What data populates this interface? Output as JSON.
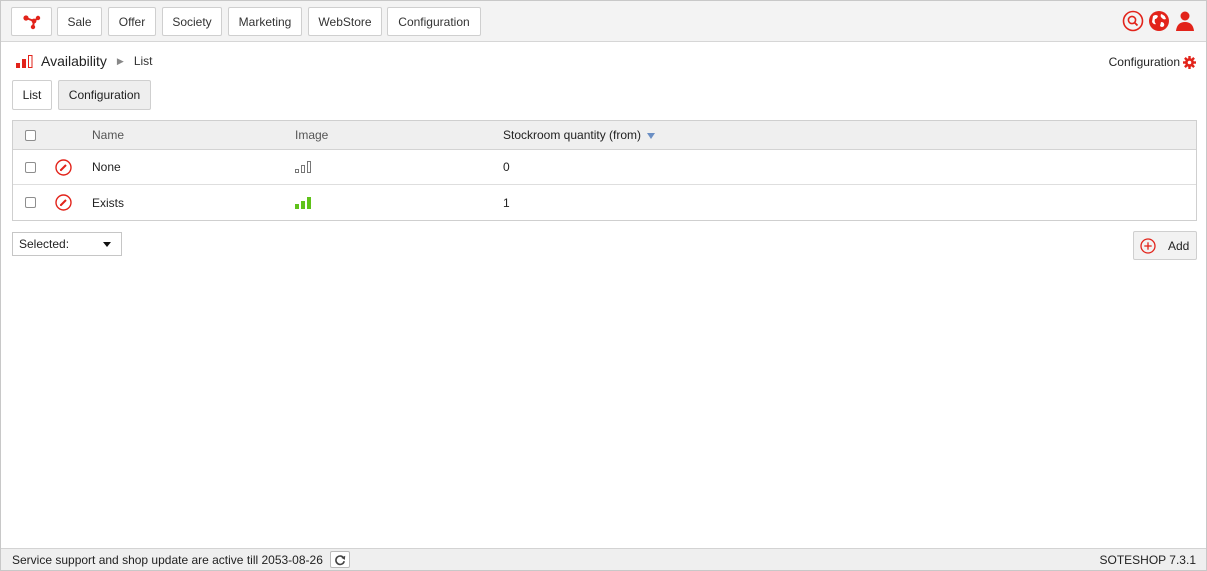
{
  "topnav": {
    "items": [
      "Sale",
      "Offer",
      "Society",
      "Marketing",
      "WebStore",
      "Configuration"
    ]
  },
  "breadcrumb": {
    "module": "Availability",
    "page": "List"
  },
  "config_link": "Configuration",
  "tabs": [
    "List",
    "Configuration"
  ],
  "table": {
    "columns": [
      "Name",
      "Image",
      "Stockroom quantity (from)"
    ],
    "rows": [
      {
        "name": "None",
        "image": "availability-none-icon",
        "quantity": "0"
      },
      {
        "name": "Exists",
        "image": "availability-exists-icon",
        "quantity": "1"
      }
    ]
  },
  "bulk_select": {
    "label": "Selected:"
  },
  "add_button": "Add",
  "footer": {
    "support_text": "Service support and shop update are active till 2053-08-26",
    "version": "SOTESHOP 7.3.1"
  },
  "colors": {
    "accent": "#e2231a",
    "available": "#5fc21a",
    "sort_arrow": "#6b8fc4"
  }
}
